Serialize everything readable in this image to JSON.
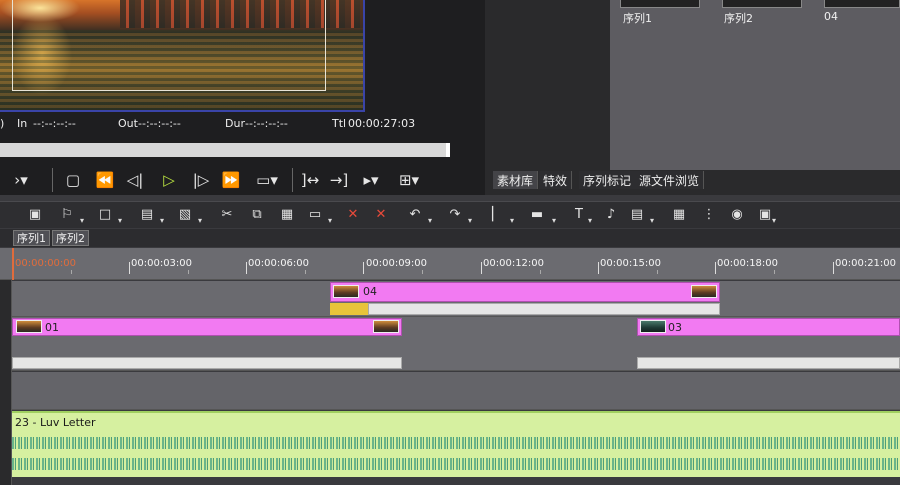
{
  "player": {
    "in_label": "In",
    "in_value": "--:--:--:--",
    "out_label": "Out",
    "out_value": "--:--:--:--",
    "dur_label": "Dur",
    "dur_value": "--:--:--:--",
    "ttl_label": "Ttl",
    "ttl_value": "00:00:27:03"
  },
  "bin": {
    "items": [
      {
        "label": "序列1"
      },
      {
        "label": "序列2"
      },
      {
        "label": "04"
      }
    ],
    "tabs": [
      "素材库",
      "特效",
      "序列标记",
      "源文件浏览"
    ]
  },
  "sequence_tabs": [
    "序列1",
    "序列2"
  ],
  "ruler": {
    "labels": [
      "00:00:00:00",
      "00:00:03:00",
      "00:00:06:00",
      "00:00:09:00",
      "00:00:12:00",
      "00:00:15:00",
      "00:00:18:00",
      "00:00:21:00"
    ]
  },
  "tracks": {
    "video_upper_clip": "04",
    "video_lower_clip_a": "01",
    "video_lower_clip_b": "03",
    "audio_clip": "23 - Luv Letter"
  },
  "colors": {
    "video_clip": "#f27af2",
    "audio_clip": "#d6f0a0",
    "playhead": "#e06c3c",
    "play_button": "#b8e040"
  }
}
